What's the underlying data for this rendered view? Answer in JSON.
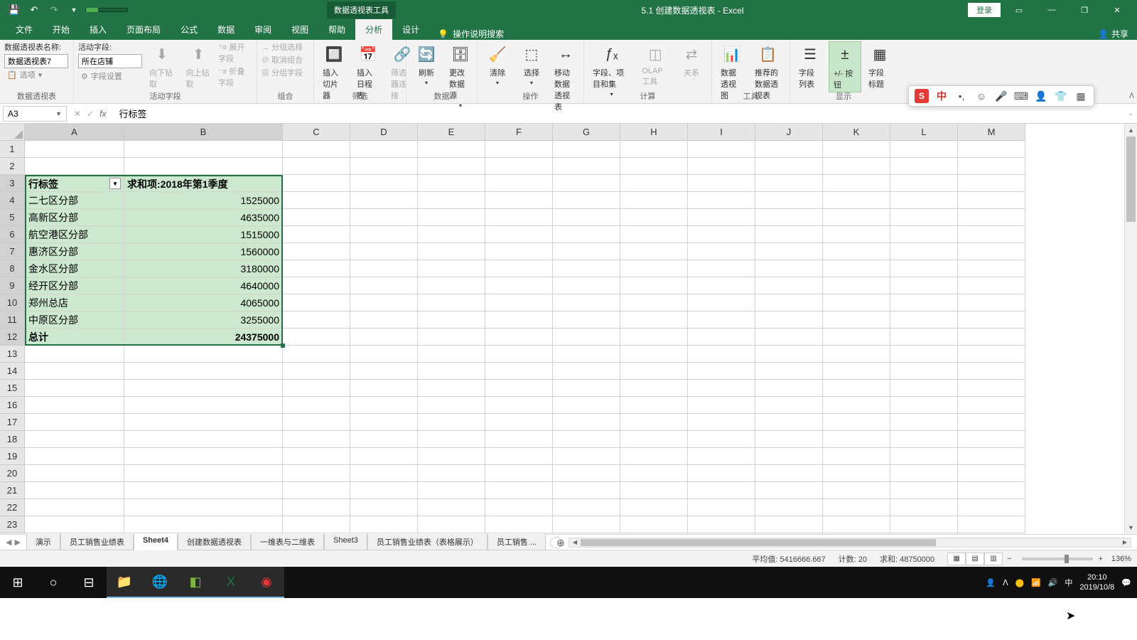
{
  "titlebar": {
    "pivot_tools": "数据透视表工具",
    "title": "5.1 创建数据透视表 - Excel",
    "login": "登录"
  },
  "tabs": {
    "file": "文件",
    "home": "开始",
    "insert": "插入",
    "layout": "页面布局",
    "formula": "公式",
    "data": "数据",
    "review": "审阅",
    "view": "视图",
    "help": "帮助",
    "analyze": "分析",
    "design": "设计",
    "tell_me": "操作说明搜索",
    "share": "共享"
  },
  "ribbon": {
    "pt_name_label": "数据透视表名称:",
    "pt_name_value": "数据透视表7",
    "options_btn": "选项",
    "group_pt": "数据透视表",
    "active_field_label": "活动字段:",
    "active_field_value": "所在店铺",
    "field_settings": "字段设置",
    "drill_down": "向下钻取",
    "drill_up": "向上钻取",
    "expand_field": "展开字段",
    "collapse_field": "折叠字段",
    "group_active": "活动字段",
    "group_sel": "分组选择",
    "ungroup": "取消组合",
    "group_field": "分组字段",
    "group_group": "组合",
    "slicer": "插入切片器",
    "timeline": "插入日程表",
    "filter_conn": "筛选器连接",
    "group_filter": "筛选",
    "refresh": "刷新",
    "change_src": "更改数据源",
    "group_data": "数据",
    "clear": "清除",
    "select": "选择",
    "move": "移动数据透视表",
    "group_actions": "操作",
    "calc_field": "字段、项目和集",
    "olap": "OLAP 工具",
    "relations": "关系",
    "group_calc": "计算",
    "pivot_chart": "数据透视图",
    "recommend": "推荐的数据透视表",
    "group_tools": "工具",
    "field_list": "字段列表",
    "pm_buttons": "+/- 按钮",
    "field_headers": "字段标题",
    "group_show": "显示"
  },
  "namebox": "A3",
  "formula": "行标签",
  "columns": [
    "A",
    "B",
    "C",
    "D",
    "E",
    "F",
    "G",
    "H",
    "I",
    "J",
    "K",
    "L",
    "M"
  ],
  "pivot": {
    "row_label": "行标签",
    "value_label": "求和项:2018年第1季度",
    "data": [
      {
        "name": "二七区分部",
        "val": "1525000"
      },
      {
        "name": "高新区分部",
        "val": "4635000"
      },
      {
        "name": "航空港区分部",
        "val": "1515000"
      },
      {
        "name": "惠济区分部",
        "val": "1560000"
      },
      {
        "name": "金水区分部",
        "val": "3180000"
      },
      {
        "name": "经开区分部",
        "val": "4640000"
      },
      {
        "name": "郑州总店",
        "val": "4065000"
      },
      {
        "name": "中原区分部",
        "val": "3255000"
      }
    ],
    "total_label": "总计",
    "total_value": "24375000"
  },
  "sheets": {
    "tabs": [
      "演示",
      "员工销售业绩表",
      "Sheet4",
      "创建数据透视表",
      "一维表与二维表",
      "Sheet3",
      "员工销售业绩表（表格展示）",
      "员工销售 ..."
    ],
    "active": 2
  },
  "status": {
    "avg_label": "平均值:",
    "avg": "5416666.667",
    "count_label": "计数:",
    "count": "20",
    "sum_label": "求和:",
    "sum": "48750000",
    "zoom": "136%"
  },
  "clock": {
    "time": "20:10",
    "date": "2019/10/8"
  }
}
